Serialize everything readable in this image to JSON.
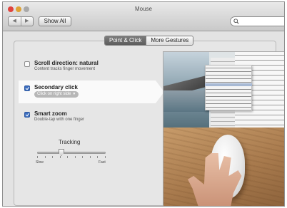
{
  "window": {
    "title": "Mouse"
  },
  "toolbar": {
    "back_label": "◀",
    "forward_label": "▶",
    "show_all_label": "Show All",
    "search_placeholder": "",
    "search_value": ""
  },
  "tabs": [
    {
      "label": "Point & Click",
      "selected": true
    },
    {
      "label": "More Gestures",
      "selected": false
    }
  ],
  "options": [
    {
      "title": "Scroll direction: natural",
      "description": "Content tracks finger movement",
      "checked": false
    },
    {
      "title": "Secondary click",
      "selected_value": "Click on right side",
      "checked": true
    },
    {
      "title": "Smart zoom",
      "description": "Double-tap with one finger",
      "checked": true
    }
  ],
  "tracking": {
    "label": "Tracking",
    "min_label": "Slow",
    "max_label": "Fast",
    "value_fraction": 0.35
  },
  "colors": {
    "accent": "#3d6fc0",
    "window_bg": "#e3e3e3"
  },
  "icons": {
    "search": "search-icon",
    "back": "chevron-left-icon",
    "forward": "chevron-right-icon"
  }
}
